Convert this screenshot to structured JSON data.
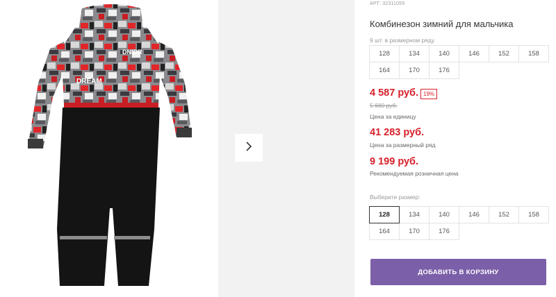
{
  "product": {
    "article": "АРТ: 32311055",
    "title": "Комбинезон зимний для мальчика",
    "pack_note": "9 шт. в размерном ряду",
    "pack_sizes": [
      "128",
      "134",
      "140",
      "146",
      "152",
      "158",
      "164",
      "170",
      "176"
    ]
  },
  "pricing": {
    "unit_price": "4 587 руб.",
    "discount": "19%",
    "old_price": "5 680 руб.",
    "unit_caption": "Цена за единицу",
    "row_price": "41 283 руб.",
    "row_caption": "Цена за размерный ряд",
    "retail_price": "9 199 руб.",
    "retail_caption": "Рекомендуемая розничная цена"
  },
  "size_selector": {
    "label": "Выберите размер:",
    "options": [
      "128",
      "134",
      "140",
      "146",
      "152",
      "158",
      "164",
      "170",
      "176"
    ],
    "selected": "128"
  },
  "cart": {
    "button_label": "ДОБАВИТЬ В КОРЗИНУ"
  },
  "gallery": {
    "next_icon": "chevron-right-icon"
  },
  "colors": {
    "accent": "#7b5fa8",
    "price": "#d6202a"
  }
}
